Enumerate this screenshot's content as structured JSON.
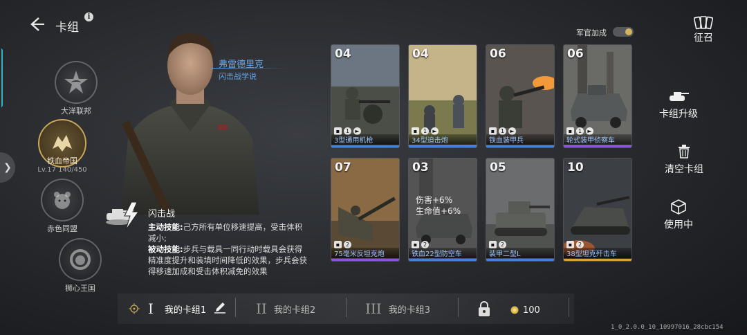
{
  "header": {
    "title": "卡组",
    "info": "i"
  },
  "factions": [
    {
      "name": "大洋联邦",
      "icon": "star-eagle-icon",
      "active": false
    },
    {
      "name": "铁血帝国",
      "icon": "iron-eagle-icon",
      "active": true,
      "level": "Lv.17  140/450"
    },
    {
      "name": "赤色同盟",
      "icon": "bear-icon",
      "active": false
    },
    {
      "name": "狮心王国",
      "icon": "lion-icon",
      "active": false
    }
  ],
  "officer": {
    "name": "弗雷德里克",
    "doctrine": "闪击战学说"
  },
  "skill": {
    "name": "闪击战",
    "active_label": "主动技能:",
    "active_text": "己方所有单位移速提高，受击体积减小;",
    "passive_label": "被动技能:",
    "passive_text": "步兵与载具一同行动时载具会获得精准度提升和装填时间降低的效果，步兵会获得移速加成和受击体积减免的效果"
  },
  "toggle": {
    "label": "军官加成",
    "on": true
  },
  "cards": [
    {
      "cost": "04",
      "name": "3型通用机枪",
      "count": "1",
      "rarity_color": "#4a7fd6",
      "art": "infantry"
    },
    {
      "cost": "04",
      "name": "34型迫击炮",
      "count": "1",
      "rarity_color": "#4a7fd6",
      "art": "mortar"
    },
    {
      "cost": "06",
      "name": "铁血装甲兵",
      "count": "1",
      "rarity_color": "#4a7fd6",
      "art": "flamer"
    },
    {
      "cost": "06",
      "name": "轮式装甲侦察车",
      "count": "1",
      "rarity_color": "#8a55d6",
      "art": "car"
    },
    {
      "cost": "07",
      "name": "75毫米反坦克炮",
      "count": "2",
      "rarity_color": "#8a55d6",
      "art": "atgun"
    },
    {
      "cost": "03",
      "name": "铁血22型防空车",
      "count": "2",
      "rarity_color": "#4a7fd6",
      "art": "aa",
      "dim": true,
      "buff": [
        "伤害+6%",
        "生命值+6%"
      ]
    },
    {
      "cost": "05",
      "name": "装甲二型L",
      "count": "2",
      "rarity_color": "#4a7fd6",
      "art": "tank"
    },
    {
      "cost": "10",
      "name": "38型坦克歼击车",
      "count": "2",
      "rarity_color": "#d3a43a",
      "art": "hunter"
    }
  ],
  "side_actions": [
    {
      "label": "征召",
      "icon": "cards-icon"
    },
    {
      "label": "卡组升级",
      "icon": "tank-upgrade-icon"
    },
    {
      "label": "清空卡组",
      "icon": "trash-icon"
    },
    {
      "label": "使用中",
      "icon": "cube-icon"
    }
  ],
  "decks": [
    {
      "numeral": "I",
      "name": "我的卡组1",
      "active": true
    },
    {
      "numeral": "II",
      "name": "我的卡组2",
      "active": false
    },
    {
      "numeral": "III",
      "name": "我的卡组3",
      "active": false
    }
  ],
  "unlock": {
    "price": "100"
  },
  "version": "1_0_2.0.0_10_10997016_28cbc154"
}
